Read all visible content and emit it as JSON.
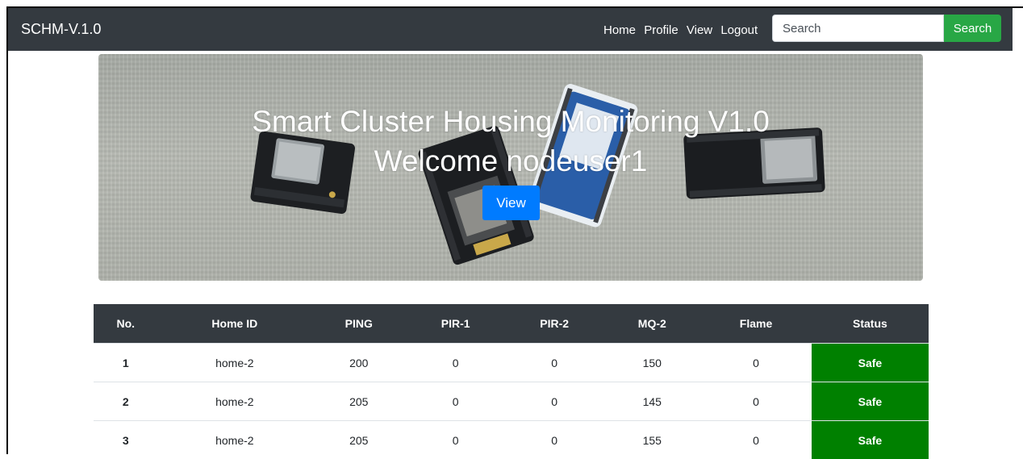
{
  "navbar": {
    "brand": "SCHM-V.1.0",
    "links": [
      "Home",
      "Profile",
      "View",
      "Logout"
    ],
    "search_placeholder": "Search",
    "search_button": "Search"
  },
  "hero": {
    "title": "Smart Cluster Housing Monitoring V1.0",
    "subtitle": "Welcome nodeuser1",
    "button": "View"
  },
  "table": {
    "headers": [
      "No.",
      "Home ID",
      "PING",
      "PIR-1",
      "PIR-2",
      "MQ-2",
      "Flame",
      "Status"
    ],
    "rows": [
      [
        "1",
        "home-2",
        "200",
        "0",
        "0",
        "150",
        "0",
        "Safe"
      ],
      [
        "2",
        "home-2",
        "205",
        "0",
        "0",
        "145",
        "0",
        "Safe"
      ],
      [
        "3",
        "home-2",
        "205",
        "0",
        "0",
        "155",
        "0",
        "Safe"
      ]
    ]
  },
  "colors": {
    "navbar": "#343a40",
    "search_button": "#28a745",
    "view_button": "#007bff",
    "status_safe": "#008000"
  }
}
